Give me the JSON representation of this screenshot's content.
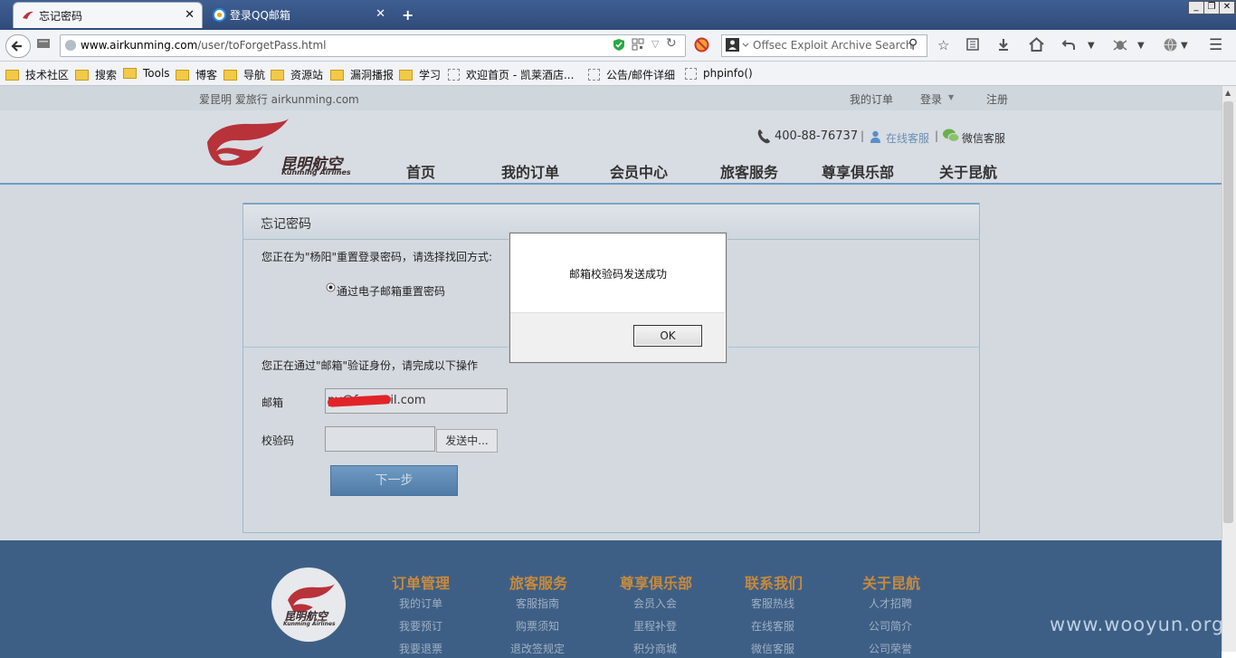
{
  "browser": {
    "tabs": [
      {
        "title": "忘记密码",
        "active": true
      },
      {
        "title": "登录QQ邮箱",
        "active": false
      }
    ],
    "window_buttons": [
      "_",
      "❐",
      "✕"
    ],
    "url_host": "www.airkunming.com",
    "url_path": "/user/toForgetPass.html",
    "search_placeholder": "Offsec Exploit Archive Search",
    "bookmarks": [
      {
        "label": "技术社区",
        "type": "folder"
      },
      {
        "label": "搜索",
        "type": "folder"
      },
      {
        "label": "Tools",
        "type": "folder"
      },
      {
        "label": "博客",
        "type": "folder"
      },
      {
        "label": "导航",
        "type": "folder"
      },
      {
        "label": "资源站",
        "type": "folder"
      },
      {
        "label": "漏洞播报",
        "type": "folder"
      },
      {
        "label": "学习",
        "type": "folder"
      },
      {
        "label": "欢迎首页 - 凯莱酒店...",
        "type": "page"
      },
      {
        "label": "公告/邮件详细",
        "type": "page"
      },
      {
        "label": "phpinfo()",
        "type": "page"
      }
    ]
  },
  "site": {
    "tagline": "爱昆明 爱旅行 airkunming.com",
    "top_links": [
      "我的订单",
      "登录",
      "注册"
    ],
    "phone": "400-88-76737",
    "online_service": "在线客服",
    "wechat_service": "微信客服",
    "logo_cn": "昆明航空",
    "logo_en": "Kunming Airlines",
    "nav": [
      "首页",
      "我的订单",
      "会员中心",
      "旅客服务",
      "尊享俱乐部",
      "关于昆航"
    ]
  },
  "form": {
    "title": "忘记密码",
    "intro": "您正在为\"杨阳\"重置登录密码，请选择找回方式:",
    "option_label": "通过电子邮箱重置密码",
    "verify_text": "您正在通过\"邮箱\"验证身份，请完成以下操作",
    "email_label": "邮箱",
    "email_value": "py@foxmail.com",
    "code_label": "校验码",
    "send_button": "发送中...",
    "next_button": "下一步"
  },
  "dialog": {
    "message": "邮箱校验码发送成功",
    "ok_label": "OK"
  },
  "footer": {
    "columns": [
      {
        "title": "订单管理",
        "links": [
          "我的订单",
          "我要预订",
          "我要退票"
        ]
      },
      {
        "title": "旅客服务",
        "links": [
          "客服指南",
          "购票须知",
          "退改签规定"
        ]
      },
      {
        "title": "尊享俱乐部",
        "links": [
          "会员入会",
          "里程补登",
          "积分商城"
        ]
      },
      {
        "title": "联系我们",
        "links": [
          "客服热线",
          "在线客服",
          "微信客服"
        ]
      },
      {
        "title": "关于昆航",
        "links": [
          "人才招聘",
          "公司简介",
          "公司荣誉"
        ]
      }
    ],
    "watermark": "www.wooyun.org"
  },
  "colors": {
    "brand_red": "#b8323a",
    "nav_blue": "#6f9cc8",
    "footer_blue": "#3e5f85",
    "footer_heading": "#c88a3c"
  }
}
